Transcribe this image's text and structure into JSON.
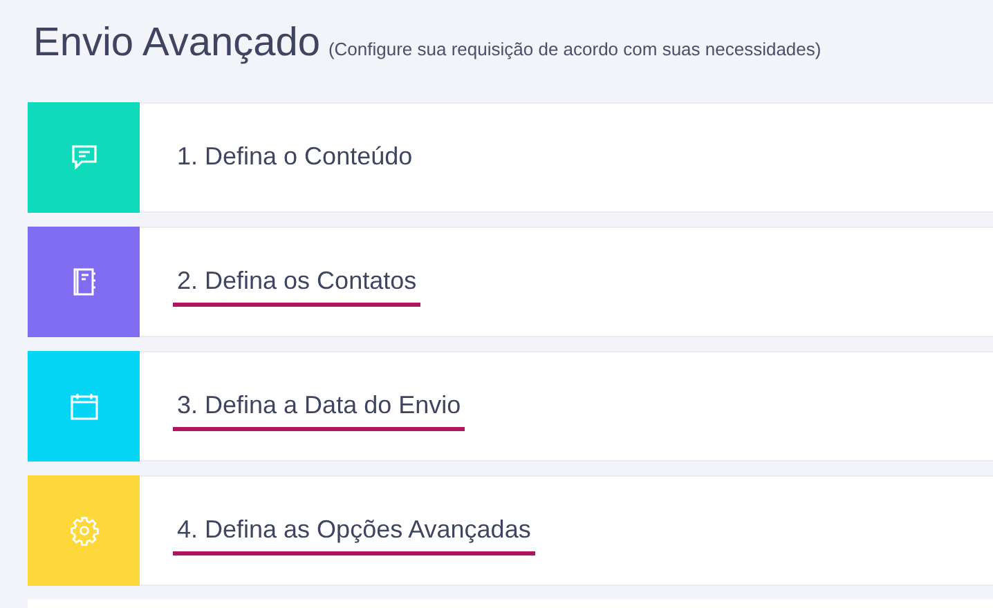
{
  "header": {
    "title": "Envio Avançado",
    "subtitle": "(Configure sua requisição de acordo com suas necessidades)"
  },
  "steps": [
    {
      "label": "1. Defina o Conteúdo",
      "kind": "chat",
      "color": "#0edbba",
      "underlined": false
    },
    {
      "label": "2. Defina os Contatos",
      "kind": "notebook",
      "color": "#7f6cf1",
      "underlined": true
    },
    {
      "label": "3. Defina a Data do Envio",
      "kind": "calendar",
      "color": "#06d6f6",
      "underlined": true
    },
    {
      "label": "4. Defina as Opções Avançadas",
      "kind": "gear",
      "color": "#fdd83b",
      "underlined": true
    }
  ]
}
